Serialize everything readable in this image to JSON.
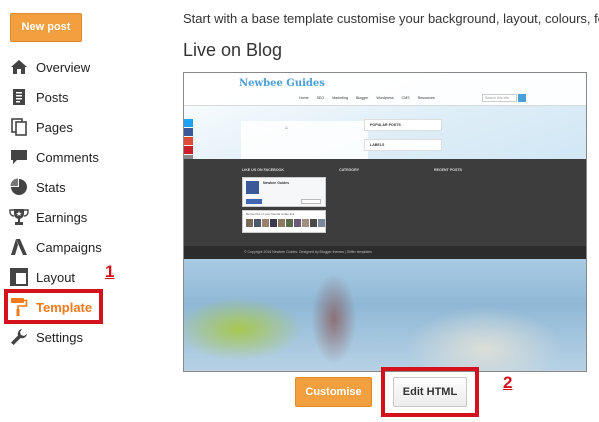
{
  "sidebar": {
    "new_post": "New post",
    "items": [
      {
        "label": "Overview",
        "icon": "home-icon"
      },
      {
        "label": "Posts",
        "icon": "posts-icon"
      },
      {
        "label": "Pages",
        "icon": "pages-icon"
      },
      {
        "label": "Comments",
        "icon": "comments-icon"
      },
      {
        "label": "Stats",
        "icon": "stats-icon"
      },
      {
        "label": "Earnings",
        "icon": "trophy-icon"
      },
      {
        "label": "Campaigns",
        "icon": "campaigns-icon"
      },
      {
        "label": "Layout",
        "icon": "layout-icon"
      },
      {
        "label": "Template",
        "icon": "paint-roller-icon",
        "active": true
      },
      {
        "label": "Settings",
        "icon": "wrench-icon"
      }
    ],
    "annotation": "1"
  },
  "main": {
    "intro": "Start with a base template customise your background, layout, colours, fo",
    "live_title": "Live on Blog",
    "preview": {
      "site_title": "Newbee Guides",
      "nav": [
        "Home",
        "SEO",
        "Marketing",
        "Blogger",
        "Wordpress",
        "CMS",
        "Resources"
      ],
      "search_placeholder": "Search this site",
      "widgets": [
        "POPULAR POSTS",
        "LABELS"
      ],
      "footer_titles": [
        "LIKE US ON FACEBOOK",
        "CATEGORY",
        "RECENT POSTS"
      ],
      "fb_page_name": "Newbee Guides",
      "fans_text": "Be the first of your friends to like this",
      "copyright": "© Copyright 2016 Newbee Guides. Designed by Blogger themes | Sliffer templates"
    },
    "buttons": {
      "customise": "Customise",
      "edit_html": "Edit HTML"
    },
    "annotation": "2"
  },
  "colors": {
    "accent_orange": "#f29f3f",
    "active_orange": "#f27a1a",
    "annotation_red": "#d4121e"
  }
}
